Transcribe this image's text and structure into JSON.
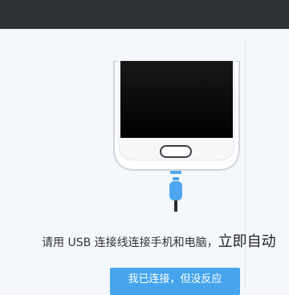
{
  "instruction": {
    "main_text": "请用 USB 连接线连接手机和电脑，",
    "link_text": "立即自动"
  },
  "connected_button": {
    "label": "我已连接，但没反应"
  },
  "colors": {
    "top_bar": "#2e3236",
    "background": "#f4f7fb",
    "accent": "#45a4ec",
    "cable": "#4ea7ee"
  },
  "icons": {
    "phone": "phone-usb-illustration"
  }
}
